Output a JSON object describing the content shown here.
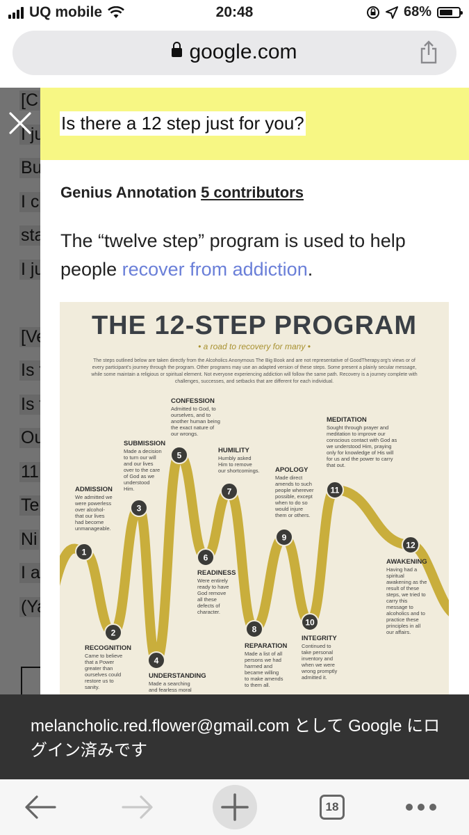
{
  "status_bar": {
    "carrier": "UQ mobile",
    "time": "20:48",
    "battery": "68%",
    "battery_level": 0.68
  },
  "url_bar": {
    "domain": "google.com"
  },
  "background_page": {
    "lines": [
      "[C",
      "I ju",
      "Bu",
      "I c",
      "sta",
      "I ju",
      "",
      "[Ve",
      "Is t",
      "Is t",
      "Ou",
      "11",
      "Te",
      "Ni",
      "I a",
      "(Ya"
    ]
  },
  "annotation": {
    "title": "Is there a 12 step just for you?",
    "label": "Genius Annotation",
    "contributors": "5 contributors",
    "body_prefix": "The “twelve step” program is used to help people ",
    "body_link": "recover from addiction",
    "body_suffix": "."
  },
  "infographic": {
    "title": "THE 12-STEP PROGRAM",
    "subtitle": "• a road to recovery for many •",
    "intro": [
      "The steps outlined below are taken directly from the Alcoholics Anonymous The Big Book and are not representative of GoodTherapy.org's views or of",
      "every participant's journey through the program. Other programs may use an adapted version of these steps. Some present a plainly secular message,",
      "while some maintain a religious or spiritual element. Not everyone experiencing addiction will follow the same path. Recovery is a journey complete with",
      "challenges, successes, and setbacks that are different for each individual."
    ],
    "steps": [
      {
        "num": "1",
        "name": "ADMISSION",
        "text": [
          "We admitted we",
          "were powerless",
          "over alcohol-",
          "that our lives",
          "had become",
          "unmanageable."
        ]
      },
      {
        "num": "2",
        "name": "RECOGNITION",
        "text": [
          "Came to believe",
          "that a Power",
          "greater than",
          "ourselves could",
          "restore us to",
          "sanity."
        ]
      },
      {
        "num": "3",
        "name": "SUBMISSION",
        "text": [
          "Made a decision",
          "to turn our will",
          "and our lives",
          "over to the care",
          "of God as we",
          "understood",
          "Him."
        ]
      },
      {
        "num": "4",
        "name": "UNDERSTANDING",
        "text": [
          "Made a searching",
          "and fearless moral"
        ]
      },
      {
        "num": "5",
        "name": "CONFESSION",
        "text": [
          "Admitted to God, to",
          "ourselves, and to",
          "another human being",
          "the exact nature of",
          "our wrongs."
        ]
      },
      {
        "num": "6",
        "name": "READINESS",
        "text": [
          "Were entirely",
          "ready to have",
          "God remove",
          "all these",
          "defects of",
          "character."
        ]
      },
      {
        "num": "7",
        "name": "HUMILITY",
        "text": [
          "Humbly asked",
          "Him to remove",
          "our shortcomings."
        ]
      },
      {
        "num": "8",
        "name": "REPARATION",
        "text": [
          "Made a list of all",
          "persons we had",
          "harmed and",
          "became willing",
          "to make amends",
          "to them all."
        ]
      },
      {
        "num": "9",
        "name": "APOLOGY",
        "text": [
          "Made direct",
          "amends to such",
          "people wherever",
          "possible, except",
          "when to do so",
          "would injure",
          "them or others."
        ]
      },
      {
        "num": "10",
        "name": "INTEGRITY",
        "text": [
          "Continued to",
          "take personal",
          "inventory and",
          "when we were",
          "wrong promptly",
          "admitted it."
        ]
      },
      {
        "num": "11",
        "name": "MEDITATION",
        "text": [
          "Sought through prayer and",
          "meditation to improve our",
          "conscious contact with God as",
          "we understood Him, praying",
          "only for knowledge of His will",
          "for us and the power to carry",
          "that out."
        ]
      },
      {
        "num": "12",
        "name": "AWAKENING",
        "text": [
          "Having had a",
          "spiritual",
          "awakening as the",
          "result of these",
          "steps, we tried to",
          "carry this",
          "message to",
          "alcoholics and to",
          "practice these",
          "principles in all",
          "our affairs."
        ]
      }
    ]
  },
  "toast": {
    "message": "melancholic.red.flower@gmail.com として Google にログイン済みです"
  },
  "toolbar": {
    "tab_count": "18"
  },
  "colors": {
    "highlight": "#f7f784",
    "link": "#6a7fd8",
    "curve": "#c9ae3c",
    "toast_bg": "#333333"
  }
}
